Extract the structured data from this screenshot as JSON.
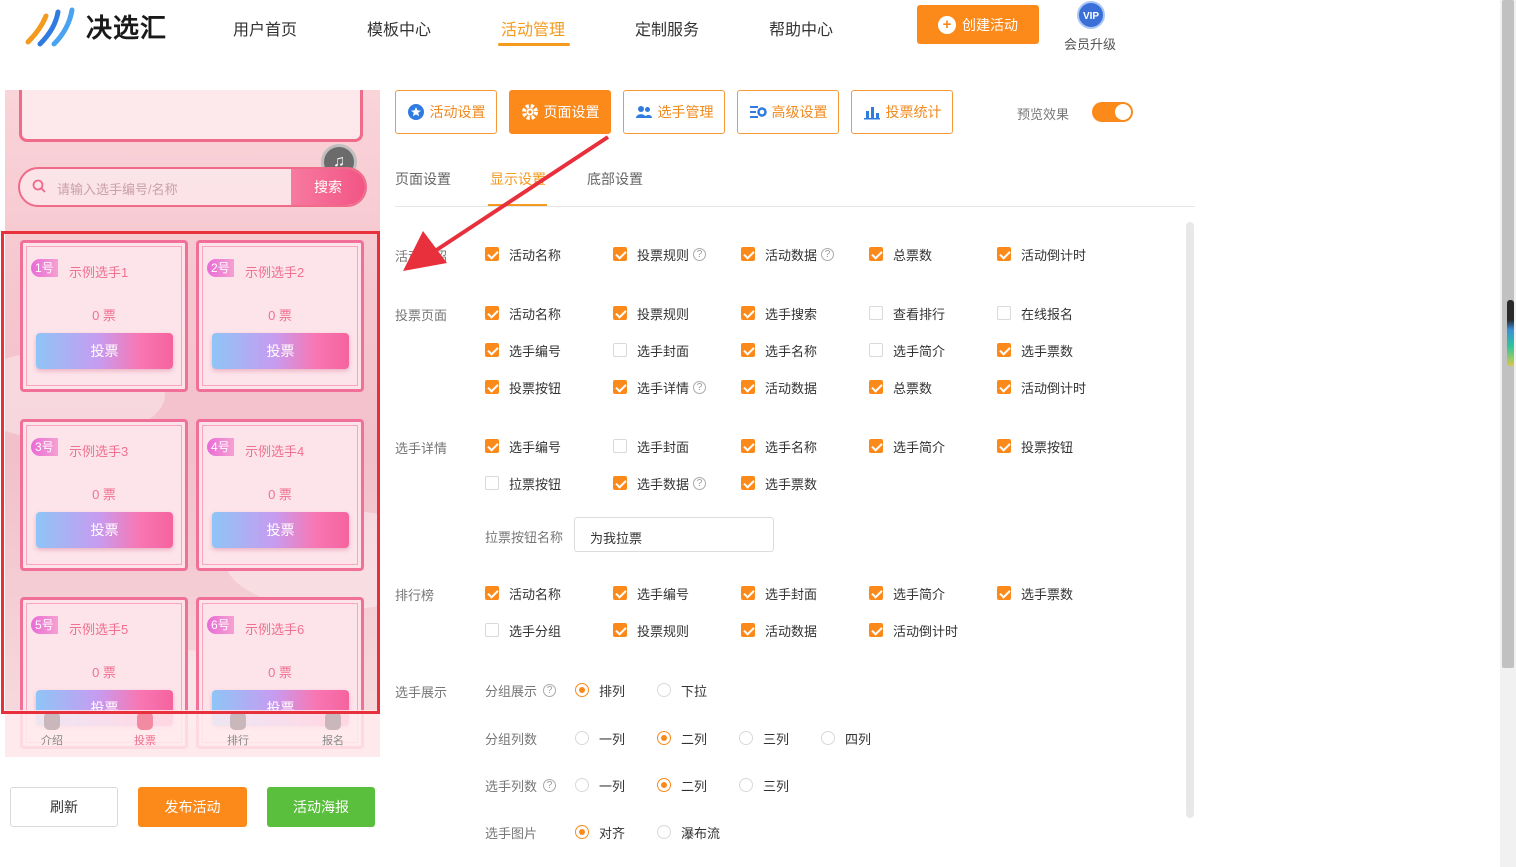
{
  "header": {
    "logo_text": "决选汇",
    "nav": [
      "用户首页",
      "模板中心",
      "活动管理",
      "定制服务",
      "帮助中心"
    ],
    "active_nav": "活动管理",
    "create_label": "创建活动",
    "vip_badge": "VIP",
    "vip_label": "会员升级",
    "accent_color": "#fb8a1b"
  },
  "phone": {
    "search_placeholder": "请输入选手编号/名称",
    "search_button": "搜索",
    "cards": [
      {
        "num": "1号",
        "name": "示例选手1",
        "votes": "0 票",
        "button": "投票"
      },
      {
        "num": "2号",
        "name": "示例选手2",
        "votes": "0 票",
        "button": "投票"
      },
      {
        "num": "3号",
        "name": "示例选手3",
        "votes": "0 票",
        "button": "投票"
      },
      {
        "num": "4号",
        "name": "示例选手4",
        "votes": "0 票",
        "button": "投票"
      },
      {
        "num": "5号",
        "name": "示例选手5",
        "votes": "0 票",
        "button": "投票"
      },
      {
        "num": "6号",
        "name": "示例选手6",
        "votes": "0 票",
        "button": "投票"
      }
    ],
    "tabs": [
      "介绍",
      "投票",
      "排行",
      "报名"
    ],
    "active_tab": "投票"
  },
  "actions": {
    "refresh": "刷新",
    "publish": "发布活动",
    "poster": "活动海报"
  },
  "toolbar": {
    "buttons": [
      "活动设置",
      "页面设置",
      "选手管理",
      "高级设置",
      "投票统计"
    ],
    "active": "页面设置",
    "preview_label": "预览效果",
    "preview_on": true
  },
  "subtabs": [
    "页面设置",
    "显示设置",
    "底部设置"
  ],
  "active_subtab": "显示设置",
  "settings": {
    "intro": {
      "label": "活动介绍",
      "options": [
        {
          "text": "活动名称",
          "on": true
        },
        {
          "text": "投票规则",
          "on": true,
          "help": "?"
        },
        {
          "text": "活动数据",
          "on": true,
          "help": "?"
        },
        {
          "text": "总票数",
          "on": true
        },
        {
          "text": "活动倒计时",
          "on": true
        }
      ]
    },
    "vote_page": {
      "label": "投票页面",
      "options": [
        {
          "text": "活动名称",
          "on": true
        },
        {
          "text": "投票规则",
          "on": true
        },
        {
          "text": "选手搜索",
          "on": true
        },
        {
          "text": "查看排行",
          "on": false
        },
        {
          "text": "在线报名",
          "on": false
        },
        {
          "text": "选手编号",
          "on": true
        },
        {
          "text": "选手封面",
          "on": false
        },
        {
          "text": "选手名称",
          "on": true
        },
        {
          "text": "选手简介",
          "on": false
        },
        {
          "text": "选手票数",
          "on": true
        },
        {
          "text": "投票按钮",
          "on": true
        },
        {
          "text": "选手详情",
          "on": true,
          "help": "?"
        },
        {
          "text": "活动数据",
          "on": true
        },
        {
          "text": "总票数",
          "on": true
        },
        {
          "text": "活动倒计时",
          "on": true
        }
      ]
    },
    "detail": {
      "label": "选手详情",
      "options": [
        {
          "text": "选手编号",
          "on": true
        },
        {
          "text": "选手封面",
          "on": false
        },
        {
          "text": "选手名称",
          "on": true
        },
        {
          "text": "选手简介",
          "on": true
        },
        {
          "text": "投票按钮",
          "on": true
        },
        {
          "text": "拉票按钮",
          "on": false
        },
        {
          "text": "选手数据",
          "on": true,
          "help": "?"
        },
        {
          "text": "选手票数",
          "on": true
        }
      ],
      "canvass_label": "拉票按钮名称",
      "canvass_value": "为我拉票"
    },
    "ranking": {
      "label": "排行榜",
      "options": [
        {
          "text": "活动名称",
          "on": true
        },
        {
          "text": "选手编号",
          "on": true
        },
        {
          "text": "选手封面",
          "on": true
        },
        {
          "text": "选手简介",
          "on": true
        },
        {
          "text": "选手票数",
          "on": true
        },
        {
          "text": "选手分组",
          "on": false
        },
        {
          "text": "投票规则",
          "on": true
        },
        {
          "text": "活动数据",
          "on": true
        },
        {
          "text": "活动倒计时",
          "on": true
        }
      ]
    },
    "display": {
      "label": "选手展示",
      "group_display": {
        "label": "分组展示",
        "help": "?",
        "options": [
          "排列",
          "下拉"
        ],
        "selected": "排列"
      },
      "group_cols": {
        "label": "分组列数",
        "options": [
          "一列",
          "二列",
          "三列",
          "四列"
        ],
        "selected": "二列"
      },
      "player_cols": {
        "label": "选手列数",
        "help": "?",
        "options": [
          "一列",
          "二列",
          "三列"
        ],
        "selected": "二列"
      },
      "player_img": {
        "label": "选手图片",
        "options": [
          "对齐",
          "瀑布流"
        ],
        "selected": "对齐"
      }
    }
  }
}
